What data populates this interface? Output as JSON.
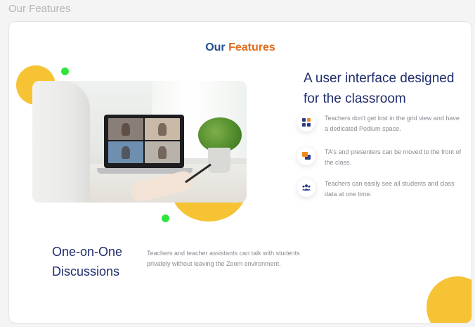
{
  "page": {
    "label": "Our Features"
  },
  "section": {
    "title_part1": "Our",
    "title_part2": "Features"
  },
  "main": {
    "heading": "A user interface designed for the classroom",
    "features": [
      {
        "icon": "grid-view-icon",
        "text": "Teachers don't get lost in the grid view and have a dedicated Podium space."
      },
      {
        "icon": "move-windows-icon",
        "text": "TA's and presenters can be moved to the front of the class."
      },
      {
        "icon": "students-group-icon",
        "text": "Teachers can easily see all students and class data at one time."
      }
    ]
  },
  "bottom": {
    "heading": "One-on-One Discussions",
    "text": "Teachers and teacher assistants can talk with students privately without leaving the Zoom environment."
  },
  "colors": {
    "title_primary": "#1e4f8d",
    "title_accent": "#e06b1c",
    "heading": "#1f2d6c",
    "blob_yellow": "#f6c335",
    "dot_green": "#2ee63f",
    "icon_primary": "#2c3a8c",
    "icon_accent": "#f08a1c"
  }
}
